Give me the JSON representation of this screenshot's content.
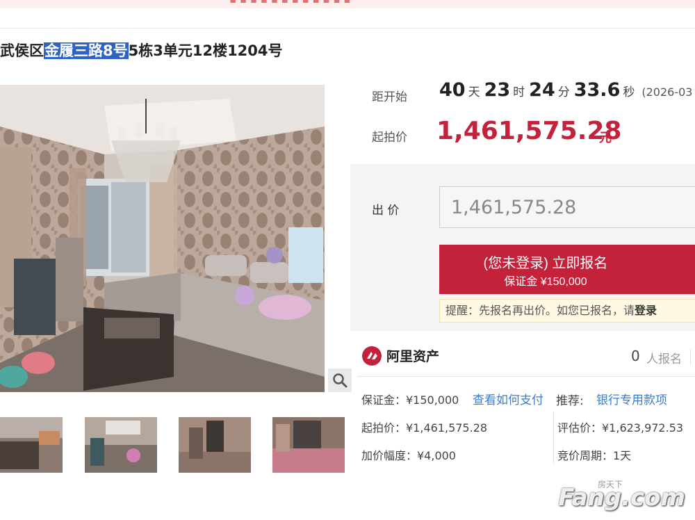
{
  "title": {
    "prefix": "武侯区",
    "highlight": "金履三路8号",
    "suffix": "5栋3单元12楼1204号"
  },
  "countdown": {
    "label": "距开始",
    "days": "40",
    "days_unit": "天",
    "hours": "23",
    "hours_unit": "时",
    "minutes": "24",
    "minutes_unit": "分",
    "seconds": "33.6",
    "seconds_unit": "秒",
    "start_date": "(2026-03"
  },
  "start_price": {
    "label": "起拍价",
    "value": "1,461,575.28",
    "unit": "元"
  },
  "bid": {
    "label": "出 价",
    "input_value": "1,461,575.28",
    "enroll_line1": "(您未登录) 立即报名",
    "enroll_line2": "保证金 ¥150,000",
    "reminder_text": "提醒：先报名再出价。如您已报名，请",
    "reminder_login": "登录"
  },
  "provider": {
    "name": "阿里资产",
    "count": "0",
    "count_label": "人报名"
  },
  "info": {
    "deposit": "保证金：¥150,000",
    "how_to_pay": "查看如何支付",
    "recommend_label": "推荐:",
    "recommend_link": "银行专用款项",
    "start_price": "起拍价：¥1,461,575.28",
    "appraisal": "评估价：¥1,623,972.53",
    "increment": "加价幅度：¥4,000",
    "period": "竞价周期：1天"
  },
  "watermark": {
    "brand": "Fang.com",
    "cn": "房天下"
  },
  "colors": {
    "accent_red": "#c4213b",
    "link_blue": "#3d7cc9",
    "highlight_blue": "#2f63c3"
  }
}
